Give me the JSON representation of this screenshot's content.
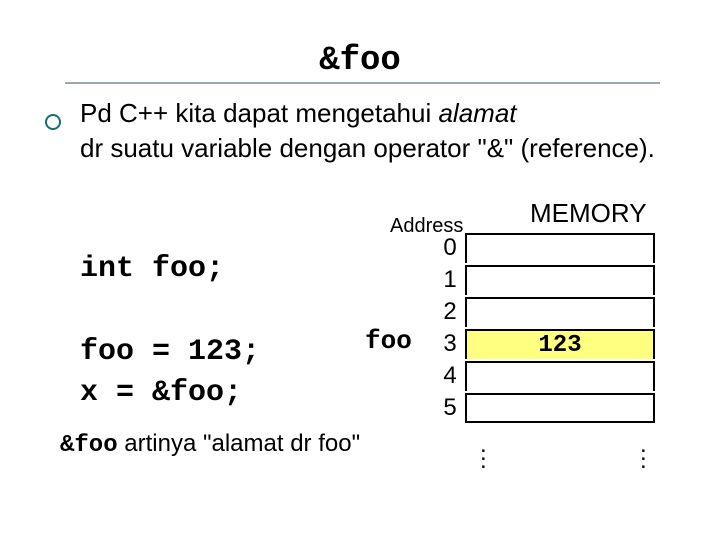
{
  "title": "&foo",
  "body_l1": "Pd C++ kita dapat mengetahui ",
  "body_l1_italic": "alamat",
  "body_l2": "dr suatu variable dengan  operator \"&\" (reference).",
  "code_decl": "int foo;",
  "code_assign": "foo = 123;\nx = &foo;",
  "footnote_code": "&foo",
  "footnote_text": " artinya \"alamat dr foo\"",
  "address_label": "Address",
  "memory_label": "MEMORY",
  "foo_ptr": "foo",
  "memory": {
    "rows": [
      {
        "index": "0",
        "value": ""
      },
      {
        "index": "1",
        "value": ""
      },
      {
        "index": "2",
        "value": ""
      },
      {
        "index": "3",
        "value": "123",
        "highlight": true
      },
      {
        "index": "4",
        "value": ""
      },
      {
        "index": "5",
        "value": ""
      }
    ]
  },
  "vdots": "..."
}
